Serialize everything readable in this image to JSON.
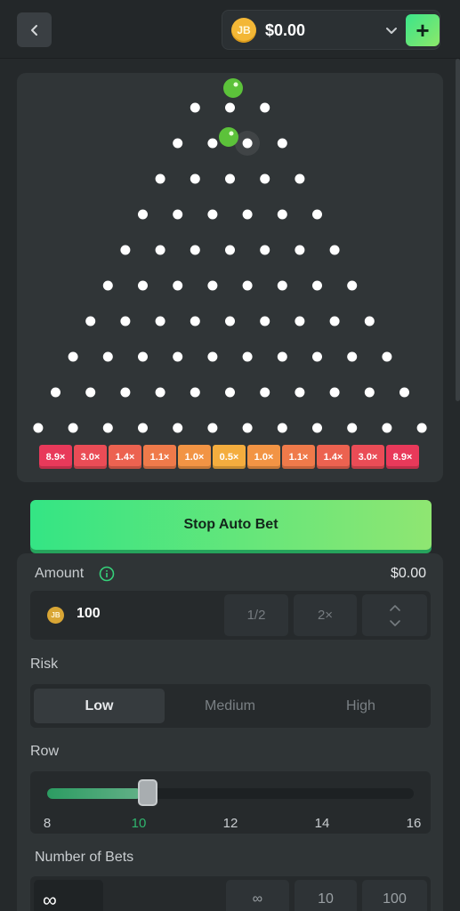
{
  "header": {
    "back_icon": "chevron-left-icon",
    "balance": "$0.00",
    "coin_label": "JB",
    "add_label": "+"
  },
  "board": {
    "rows_shown": 10,
    "multipliers": [
      {
        "label": "8.9×",
        "color": "#e8395a"
      },
      {
        "label": "3.0×",
        "color": "#ea4c56"
      },
      {
        "label": "1.4×",
        "color": "#ec6250"
      },
      {
        "label": "1.1×",
        "color": "#ef7a4a"
      },
      {
        "label": "1.0×",
        "color": "#f29444"
      },
      {
        "label": "0.5×",
        "color": "#f4ad3e"
      },
      {
        "label": "1.0×",
        "color": "#f29444"
      },
      {
        "label": "1.1×",
        "color": "#ef7a4a"
      },
      {
        "label": "1.4×",
        "color": "#ec6250"
      },
      {
        "label": "3.0×",
        "color": "#ea4c56"
      },
      {
        "label": "8.9×",
        "color": "#e8395a"
      }
    ],
    "ball_color": "#5cc23a",
    "pin_color": "#ffffff"
  },
  "action": {
    "label": "Stop Auto Bet"
  },
  "amount": {
    "label": "Amount",
    "usd_value": "$0.00",
    "value": "100",
    "coin_label": "JB",
    "half_label": "1/2",
    "double_label": "2×"
  },
  "risk": {
    "label": "Risk",
    "options": [
      "Low",
      "Medium",
      "High"
    ],
    "selected": "Low"
  },
  "row": {
    "label": "Row",
    "ticks": [
      "8",
      "10",
      "12",
      "14",
      "16"
    ],
    "min": 8,
    "max": 16,
    "value": 10
  },
  "bets": {
    "label": "Number of Bets",
    "value": "∞",
    "options": [
      "∞",
      "10",
      "100"
    ]
  }
}
